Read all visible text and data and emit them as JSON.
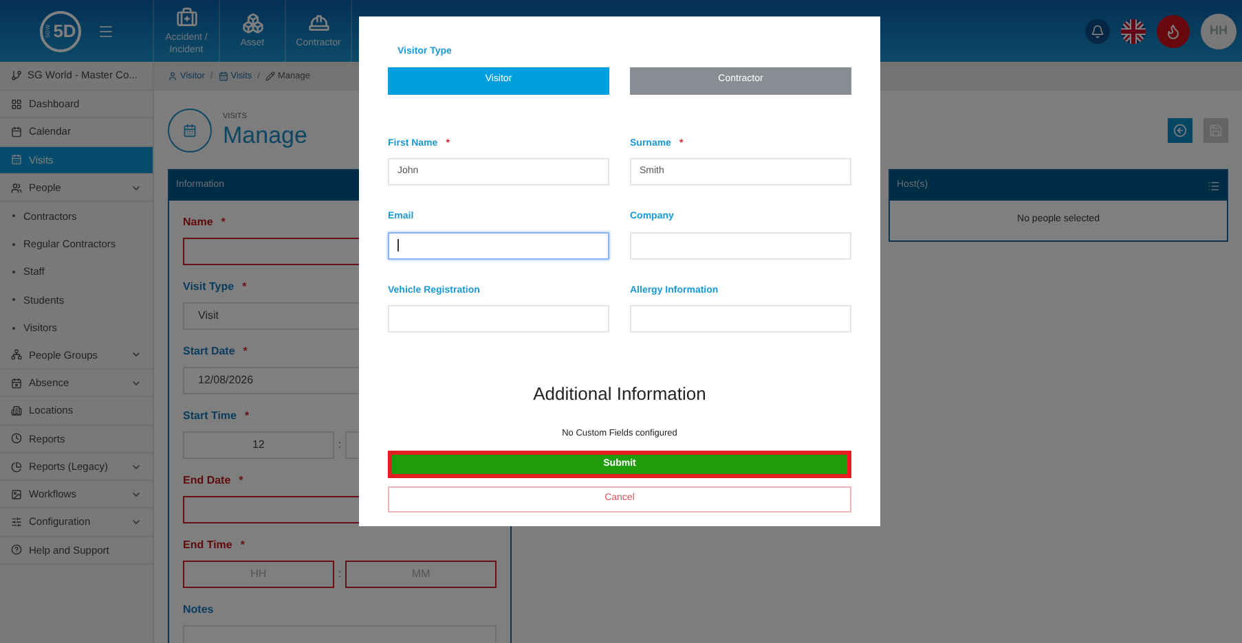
{
  "topbar": {
    "logo_prefix": "SGW",
    "logo_text": "5D",
    "nav_items": [
      {
        "label": "Accident / Incident",
        "kind": "medical"
      },
      {
        "label": "Asset",
        "kind": "boxes"
      },
      {
        "label": "Contractor",
        "kind": "hardhat"
      }
    ],
    "avatar": "HH"
  },
  "sidebar": {
    "org": "SG World - Master Co...",
    "items": [
      {
        "label": "Dashboard",
        "kind": "dashboard",
        "selected": false,
        "expandable": false
      },
      {
        "label": "Calendar",
        "kind": "calendar",
        "selected": false,
        "expandable": false
      },
      {
        "label": "Visits",
        "kind": "visits",
        "selected": true,
        "expandable": false
      },
      {
        "label": "People",
        "kind": "people",
        "selected": false,
        "expandable": true,
        "children": [
          {
            "label": "Contractors"
          },
          {
            "label": "Regular Contractors"
          },
          {
            "label": "Staff"
          },
          {
            "label": "Students"
          },
          {
            "label": "Visitors"
          }
        ]
      },
      {
        "label": "People Groups",
        "kind": "groups",
        "selected": false,
        "expandable": true
      },
      {
        "label": "Absence",
        "kind": "absence",
        "selected": false,
        "expandable": true
      },
      {
        "label": "Locations",
        "kind": "locations",
        "selected": false,
        "expandable": false
      },
      {
        "label": "Reports",
        "kind": "reports",
        "selected": false,
        "expandable": false
      },
      {
        "label": "Reports (Legacy)",
        "kind": "legacy",
        "selected": false,
        "expandable": true
      },
      {
        "label": "Workflows",
        "kind": "workflows",
        "selected": false,
        "expandable": true
      },
      {
        "label": "Configuration",
        "kind": "config",
        "selected": false,
        "expandable": true
      },
      {
        "label": "Help and Support",
        "kind": "help",
        "selected": false,
        "expandable": false
      }
    ]
  },
  "breadcrumb": {
    "separator": "/",
    "items": [
      {
        "label": "Visitor",
        "kind": "user"
      },
      {
        "label": "Visits",
        "kind": "visits"
      },
      {
        "label": "Manage",
        "kind": "edit"
      }
    ]
  },
  "required_mark": "*",
  "page_header": {
    "section": "VISITS",
    "title": "Manage"
  },
  "info_panel": {
    "title": "Information",
    "time_separator": ":",
    "fields": [
      {
        "label": "Name",
        "kind": "text",
        "required": true,
        "invalid": true
      },
      {
        "label": "Visit Type",
        "kind": "select",
        "required": true,
        "invalid": false,
        "value": "Visit"
      },
      {
        "label": "Start Date",
        "kind": "text",
        "required": true,
        "invalid": false,
        "value": "12/08/2026"
      },
      {
        "label": "Start Time",
        "kind": "time",
        "required": true,
        "invalid": false,
        "hours": "12"
      },
      {
        "label": "End Date",
        "kind": "text",
        "required": true,
        "invalid": true
      },
      {
        "label": "End Time",
        "kind": "time",
        "required": true,
        "invalid": true,
        "hours_placeholder": "HH",
        "minutes_placeholder": "MM"
      },
      {
        "label": "Notes",
        "kind": "textarea",
        "required": false,
        "invalid": false
      }
    ]
  },
  "hosts_panel": {
    "title": "Host(s)",
    "empty_text": "No people selected"
  },
  "modal": {
    "visitor_type_label": "Visitor Type",
    "visitor_types": [
      {
        "label": "Visitor",
        "selected": true
      },
      {
        "label": "Contractor",
        "selected": false
      }
    ],
    "fields": [
      {
        "label": "First Name",
        "required": true,
        "value": "John",
        "focused": false
      },
      {
        "label": "Surname",
        "required": true,
        "value": "Smith",
        "focused": false
      },
      {
        "label": "Email",
        "required": false,
        "focused": true
      },
      {
        "label": "Company",
        "required": false,
        "focused": false
      },
      {
        "label": "Vehicle Registration",
        "required": false,
        "focused": false
      },
      {
        "label": "Allergy Information",
        "required": false,
        "focused": false
      }
    ],
    "additional_heading": "Additional Information",
    "custom_fields_text": "No Custom Fields configured",
    "submit": "Submit",
    "cancel": "Cancel"
  }
}
